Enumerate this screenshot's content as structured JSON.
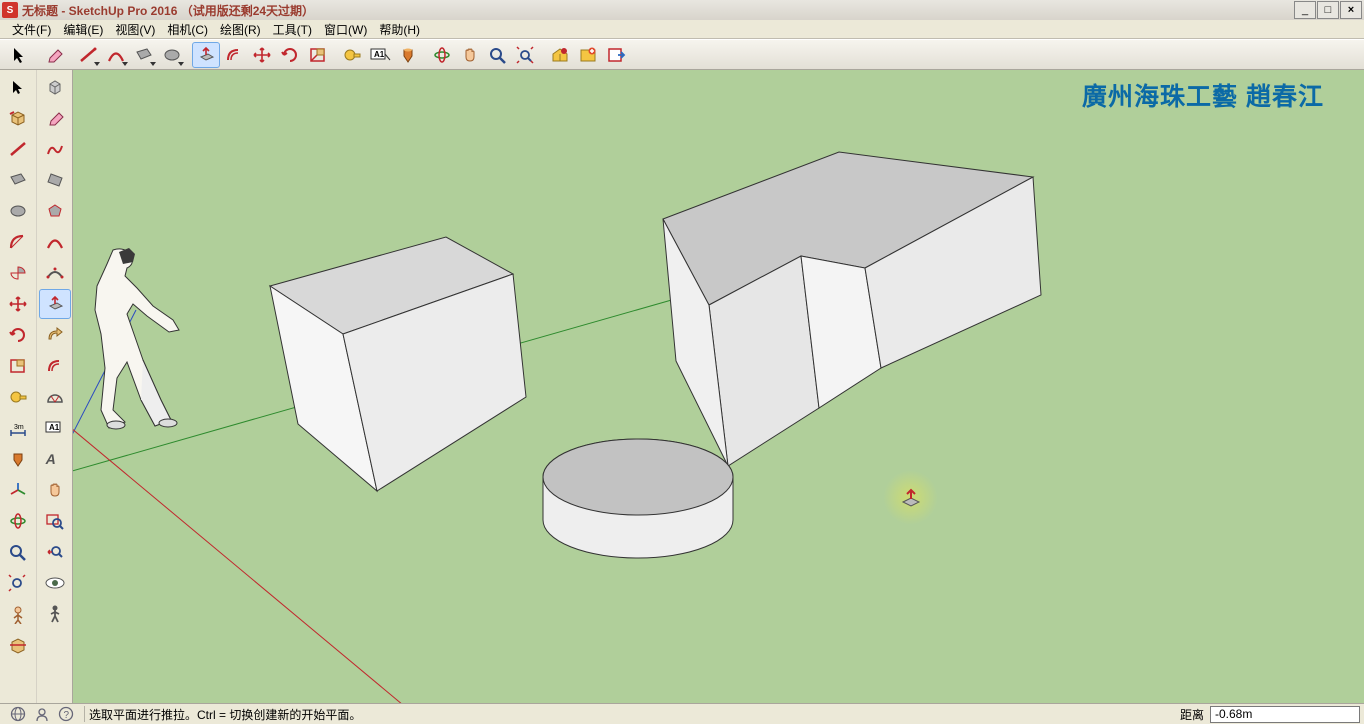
{
  "title": "无标题 - SketchUp Pro 2016 （试用版还剩24天过期）",
  "menu": {
    "file": "文件(F)",
    "edit": "编辑(E)",
    "view": "视图(V)",
    "camera": "相机(C)",
    "draw": "绘图(R)",
    "tools": "工具(T)",
    "window": "窗口(W)",
    "help": "帮助(H)"
  },
  "watermark": "廣州海珠工藝  趙春江",
  "status": {
    "hint": "选取平面进行推拉。Ctrl = 切换创建新的开始平面。",
    "measure_label": "距离",
    "measure_value": "-0.68m"
  },
  "icons": {
    "select": "select-icon",
    "eraser": "eraser-icon",
    "line": "line-icon",
    "arc": "arc-icon",
    "rect": "rect-icon",
    "circle": "circle-icon",
    "pushpull": "pushpull-icon",
    "offset": "offset-icon",
    "move": "move-icon",
    "rotate": "rotate-icon",
    "scale": "scale-icon",
    "tape": "tape-icon",
    "protractor": "protractor-icon",
    "text": "text-icon",
    "paint": "paint-icon",
    "orbit": "orbit-icon",
    "pan": "pan-icon",
    "zoom": "zoom-icon",
    "zoomext": "zoom-extents-icon",
    "warehouse": "3dwarehouse-icon",
    "ext": "extensions-icon",
    "layout": "layout-icon",
    "freehand": "freehand-icon",
    "polygon": "polygon-icon",
    "pie": "pie-icon",
    "followme": "followme-icon",
    "axes": "axes-icon",
    "dim": "dimension-icon",
    "section": "section-icon",
    "walk": "walk-icon",
    "look": "look-icon",
    "position": "position-icon",
    "geo": "geo-icon",
    "help": "help-icon",
    "user": "user-icon",
    "outliner": "outliner-icon"
  }
}
